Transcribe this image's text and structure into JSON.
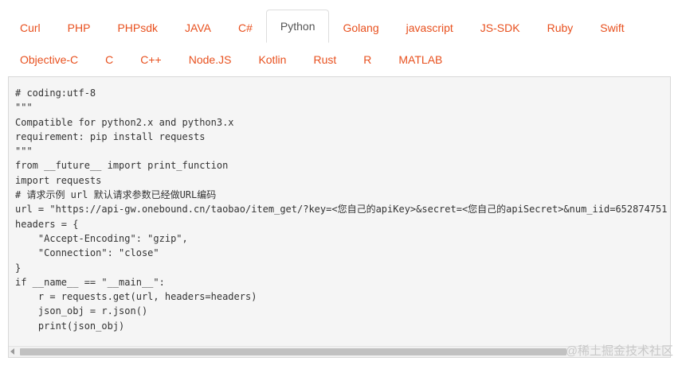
{
  "tabs_row1": [
    {
      "label": "Curl"
    },
    {
      "label": "PHP"
    },
    {
      "label": "PHPsdk"
    },
    {
      "label": "JAVA"
    },
    {
      "label": "C#"
    },
    {
      "label": "Python",
      "active": true
    },
    {
      "label": "Golang"
    },
    {
      "label": "javascript"
    },
    {
      "label": "JS-SDK"
    },
    {
      "label": "Ruby"
    },
    {
      "label": "Swift"
    }
  ],
  "tabs_row2": [
    {
      "label": "Objective-C"
    },
    {
      "label": "C"
    },
    {
      "label": "C++"
    },
    {
      "label": "Node.JS"
    },
    {
      "label": "Kotlin"
    },
    {
      "label": "Rust"
    },
    {
      "label": "R"
    },
    {
      "label": "MATLAB"
    }
  ],
  "code_lines": [
    "# coding:utf-8",
    "\"\"\"",
    "Compatible for python2.x and python3.x",
    "requirement: pip install requests",
    "\"\"\"",
    "from __future__ import print_function",
    "import requests",
    "# 请求示例 url 默认请求参数已经做URL编码",
    "url = \"https://api-gw.onebound.cn/taobao/item_get/?key=<您自己的apiKey>&secret=<您自己的apiSecret>&num_iid=652874751",
    "headers = {",
    "    \"Accept-Encoding\": \"gzip\",",
    "    \"Connection\": \"close\"",
    "}",
    "if __name__ == \"__main__\":",
    "    r = requests.get(url, headers=headers)",
    "    json_obj = r.json()",
    "    print(json_obj)"
  ],
  "watermark": "@稀土掘金技术社区",
  "colors": {
    "tab_text": "#e8501e",
    "active_tab_text": "#555555",
    "code_bg": "#f5f5f5"
  }
}
